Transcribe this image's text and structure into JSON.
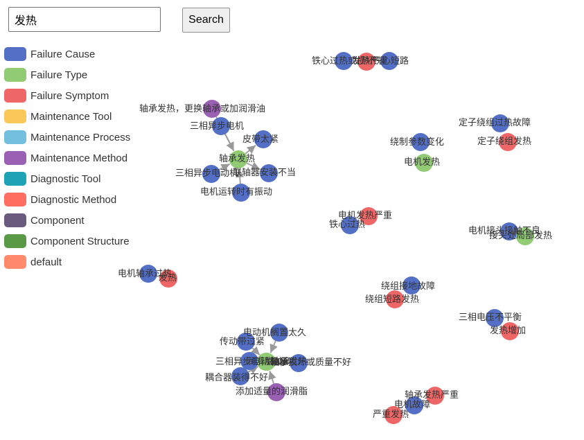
{
  "search": {
    "value": "发热",
    "button_label": "Search"
  },
  "legend": [
    {
      "label": "Failure Cause",
      "color": "#5470c6"
    },
    {
      "label": "Failure Type",
      "color": "#91cc75"
    },
    {
      "label": "Failure Symptom",
      "color": "#ee6666"
    },
    {
      "label": "Maintenance Tool",
      "color": "#fac858"
    },
    {
      "label": "Maintenance Process",
      "color": "#73c0de"
    },
    {
      "label": "Maintenance Method",
      "color": "#9a60b4"
    },
    {
      "label": "Diagnostic Tool",
      "color": "#1ea3b5"
    },
    {
      "label": "Diagnostic Method",
      "color": "#ff6f61"
    },
    {
      "label": "Component",
      "color": "#6a5a7e"
    },
    {
      "label": "Component Structure",
      "color": "#5a9a47"
    },
    {
      "label": "default",
      "color": "#ff8a6b"
    }
  ],
  "graph": {
    "nodes": [
      {
        "id": "n1",
        "label": "铁心过热或损坏",
        "category": "Failure Cause"
      },
      {
        "id": "n2",
        "label": "发热严重",
        "category": "Failure Symptom"
      },
      {
        "id": "n3",
        "label": "铁心短路",
        "category": "Failure Cause"
      },
      {
        "id": "n4",
        "label": "轴承发热，更换轴承或加润滑油",
        "category": "Maintenance Method"
      },
      {
        "id": "n5",
        "label": "三相异步电机",
        "category": "Failure Cause"
      },
      {
        "id": "n6",
        "label": "皮带太紧",
        "category": "Failure Cause"
      },
      {
        "id": "n7",
        "label": "轴承发热",
        "category": "Failure Type"
      },
      {
        "id": "n8",
        "label": "三相异步电动机",
        "category": "Failure Cause"
      },
      {
        "id": "n9",
        "label": "联轴器安装不当",
        "category": "Failure Cause"
      },
      {
        "id": "n10",
        "label": "电机运转时有振动",
        "category": "Failure Cause"
      },
      {
        "id": "n11",
        "label": "定子绕组过热故障",
        "category": "Failure Cause"
      },
      {
        "id": "n12",
        "label": "定子绕组发热",
        "category": "Failure Symptom"
      },
      {
        "id": "n13",
        "label": "绕制参数变化",
        "category": "Failure Cause"
      },
      {
        "id": "n14",
        "label": "电机发热",
        "category": "Failure Type"
      },
      {
        "id": "n15",
        "label": "电机发热严重",
        "category": "Failure Symptom"
      },
      {
        "id": "n16",
        "label": "铁心过热",
        "category": "Failure Cause"
      },
      {
        "id": "n17",
        "label": "电机接头接触不良",
        "category": "Failure Cause"
      },
      {
        "id": "n18",
        "label": "接头处局部发热",
        "category": "Failure Type"
      },
      {
        "id": "n19",
        "label": "电机轴承过热",
        "category": "Failure Cause"
      },
      {
        "id": "n20",
        "label": "发热",
        "category": "Failure Symptom"
      },
      {
        "id": "n21",
        "label": "绕组接地故障",
        "category": "Failure Cause"
      },
      {
        "id": "n22",
        "label": "绕组短路发热",
        "category": "Failure Symptom"
      },
      {
        "id": "n23",
        "label": "三相电压不平衡",
        "category": "Failure Cause"
      },
      {
        "id": "n24",
        "label": "发热增加",
        "category": "Failure Symptom"
      },
      {
        "id": "n25",
        "label": "电动机搁置太久",
        "category": "Failure Cause"
      },
      {
        "id": "n26",
        "label": "传动带过紧",
        "category": "Failure Cause"
      },
      {
        "id": "n27",
        "label": "三相异步电动机",
        "category": "Failure Cause"
      },
      {
        "id": "n28",
        "label": "润滑脂过多",
        "category": "Failure Type"
      },
      {
        "id": "n29",
        "label": "轴承发热",
        "category": "Failure Type"
      },
      {
        "id": "n30",
        "label": "轴承损坏或质量不好",
        "category": "Failure Cause"
      },
      {
        "id": "n31",
        "label": "耦合器装得不好",
        "category": "Failure Cause"
      },
      {
        "id": "n32",
        "label": "添加适量的润滑脂",
        "category": "Maintenance Method"
      },
      {
        "id": "n33",
        "label": "轴承发热严重",
        "category": "Failure Symptom"
      },
      {
        "id": "n34",
        "label": "电机故障",
        "category": "Failure Cause"
      },
      {
        "id": "n35",
        "label": "严重发热",
        "category": "Failure Symptom"
      }
    ],
    "edges": [
      {
        "source": "n4",
        "target": "n7"
      },
      {
        "source": "n5",
        "target": "n7"
      },
      {
        "source": "n7",
        "target": "n6"
      },
      {
        "source": "n8",
        "target": "n7"
      },
      {
        "source": "n7",
        "target": "n9"
      },
      {
        "source": "n10",
        "target": "n7"
      },
      {
        "source": "n25",
        "target": "n29"
      },
      {
        "source": "n26",
        "target": "n29"
      },
      {
        "source": "n27",
        "target": "n29"
      },
      {
        "source": "n28",
        "target": "n29"
      },
      {
        "source": "n29",
        "target": "n30"
      },
      {
        "source": "n31",
        "target": "n29"
      },
      {
        "source": "n32",
        "target": "n29"
      }
    ]
  }
}
